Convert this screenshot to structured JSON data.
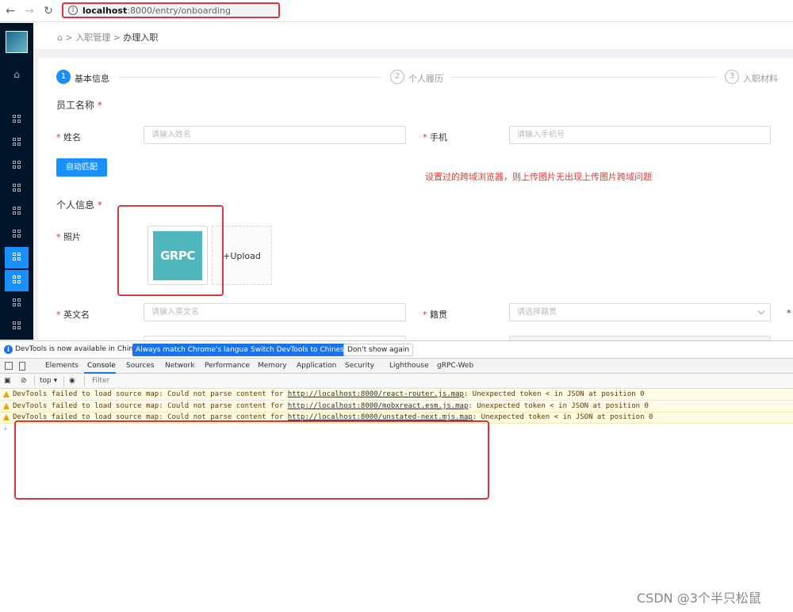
{
  "browser": {
    "url_host": "localhost",
    "url_rest": ":8000/entry/onboarding"
  },
  "breadcrumb": {
    "items": [
      "入职管理",
      "办理入职"
    ],
    "separator": ">"
  },
  "steps": [
    {
      "num": "1",
      "label": "基本信息"
    },
    {
      "num": "2",
      "label": "个人履历"
    },
    {
      "num": "3",
      "label": "入职材料"
    }
  ],
  "form": {
    "section_employee": "员工名称",
    "name_label": "姓名",
    "name_placeholder": "请输入姓名",
    "phone_label": "手机",
    "phone_placeholder": "请输入手机号",
    "auto_match_button": "自动匹配",
    "annotation": "设置过的跨域浏览器，则上传图片无出现上传图片跨域问题",
    "section_personal": "个人信息",
    "photo_label": "照片",
    "photo_thumb_text": "GRPC",
    "upload_label": "+Upload",
    "english_name_label": "英文名",
    "english_name_placeholder": "请输入英文名",
    "native_place_label": "籍贯",
    "native_place_placeholder": "请选择籍贯",
    "required_mark": "*"
  },
  "devtools": {
    "banner_text": "DevTools is now available in Chinese!",
    "banner_btn_match": "Always match Chrome's language",
    "banner_btn_switch": "Switch DevTools to Chinese",
    "banner_btn_dismiss": "Don't show again",
    "tabs": [
      "Elements",
      "Console",
      "Sources",
      "Network",
      "Performance",
      "Memory",
      "Application",
      "Security",
      "Lighthouse",
      "gRPC-Web"
    ],
    "active_tab": "Console",
    "context": "top ▾",
    "filter_placeholder": "Filter",
    "messages": [
      {
        "prefix": "DevTools failed to load source map: Could not parse content for ",
        "link": "http://localhost:8000/react-router.js.map",
        "suffix": ": Unexpected token < in JSON at position 0"
      },
      {
        "prefix": "DevTools failed to load source map: Could not parse content for ",
        "link": "http://localhost:8000/mobxreact.esm.js.map",
        "suffix": ": Unexpected token < in JSON at position 0"
      },
      {
        "prefix": "DevTools failed to load source map: Could not parse content for ",
        "link": "http://localhost:8000/unstated-next.mjs.map",
        "suffix": ": Unexpected token < in JSON at position 0"
      }
    ],
    "prompt": "›"
  },
  "watermark": "CSDN @3个半只松鼠",
  "colors": {
    "primary": "#1890ff",
    "sidebar_bg": "#001529",
    "annotation_red": "#d9363e",
    "warning_bg": "#fffbe5"
  }
}
